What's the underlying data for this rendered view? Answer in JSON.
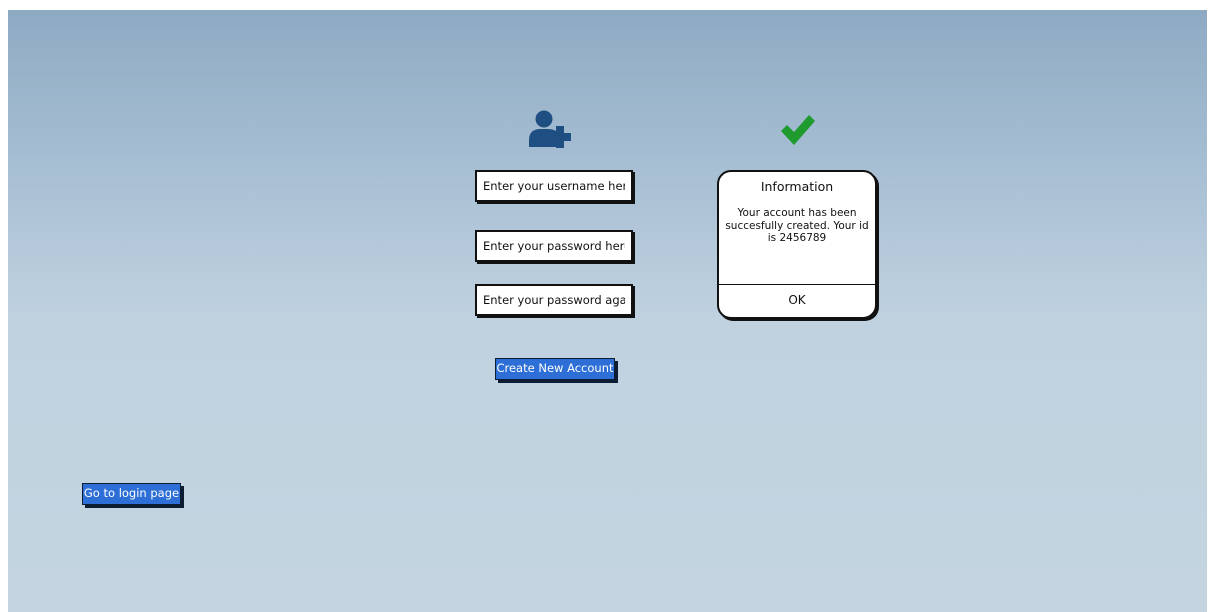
{
  "form": {
    "username_placeholder": "Enter your username here",
    "password_placeholder": "Enter your password here",
    "password_again_placeholder": "Enter your password again",
    "create_button_label": "Create New Account"
  },
  "dialog": {
    "title": "Information",
    "message": "Your account has been succesfully created. Your id is 2456789",
    "ok_label": "OK"
  },
  "navigation": {
    "login_button_label": "Go to login page"
  },
  "icons": {
    "add_user": "add-user-icon",
    "success": "checkmark-icon"
  },
  "colors": {
    "button_blue": "#2d6fd6",
    "icon_navy": "#1f4e82",
    "success_green": "#1e9a2e",
    "background_top": "#8eaac3",
    "background_bottom": "#c4d4e1"
  }
}
